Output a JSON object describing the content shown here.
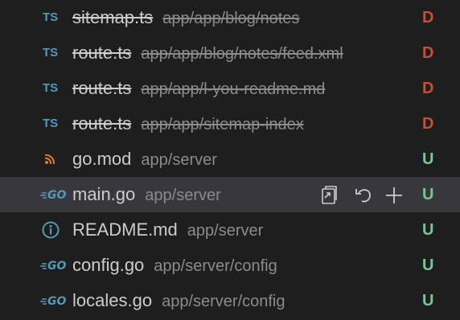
{
  "colors": {
    "background": "#1e1e1e",
    "selected_row": "#37373d",
    "filename": "#cccccc",
    "path": "#8b8b8b",
    "deleted_status": "#c74e39",
    "untracked_status": "#73c991",
    "ts_icon": "#519aba",
    "go_icon": "#519aba",
    "rss_icon": "#e37933"
  },
  "rows": [
    {
      "icon": "ts-icon",
      "icon_text": "TS",
      "filename": "sitemap.ts",
      "path": "app/app/blog/notes",
      "status": "D",
      "deleted": true
    },
    {
      "icon": "ts-icon",
      "icon_text": "TS",
      "filename": "route.ts",
      "path": "app/app/blog/notes/feed.xml",
      "status": "D",
      "deleted": true
    },
    {
      "icon": "ts-icon",
      "icon_text": "TS",
      "filename": "route.ts",
      "path": "app/app/l-you-readme.md",
      "status": "D",
      "deleted": true
    },
    {
      "icon": "ts-icon",
      "icon_text": "TS",
      "filename": "route.ts",
      "path": "app/app/sitemap-index",
      "status": "D",
      "deleted": true
    },
    {
      "icon": "rss-icon",
      "filename": "go.mod",
      "path": "app/server",
      "status": "U",
      "deleted": false
    },
    {
      "icon": "go-icon",
      "filename": "main.go",
      "path": "app/server",
      "status": "U",
      "deleted": false,
      "selected": true
    },
    {
      "icon": "info-icon",
      "filename": "README.md",
      "path": "app/server",
      "status": "U",
      "deleted": false
    },
    {
      "icon": "go-icon",
      "filename": "config.go",
      "path": "app/server/config",
      "status": "U",
      "deleted": false
    },
    {
      "icon": "go-icon",
      "filename": "locales.go",
      "path": "app/server/config",
      "status": "U",
      "deleted": false
    }
  ],
  "row_actions": [
    {
      "name": "open-file-icon"
    },
    {
      "name": "discard-changes-icon"
    },
    {
      "name": "stage-changes-icon"
    }
  ]
}
